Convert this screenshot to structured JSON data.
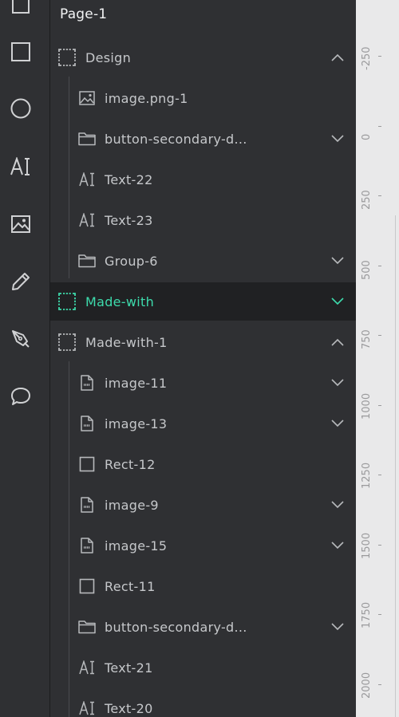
{
  "toolbar": {
    "tools": [
      {
        "name": "frame-tool",
        "icon": "frame-icon"
      },
      {
        "name": "rectangle-tool",
        "icon": "rectangle-icon"
      },
      {
        "name": "ellipse-tool",
        "icon": "circle-icon"
      },
      {
        "name": "text-tool",
        "icon": "text-icon"
      },
      {
        "name": "image-tool",
        "icon": "image-icon"
      },
      {
        "name": "pencil-tool",
        "icon": "pencil-icon"
      },
      {
        "name": "pen-tool",
        "icon": "pen-icon"
      },
      {
        "name": "comment-tool",
        "icon": "comment-icon"
      }
    ]
  },
  "layers": {
    "page_title": "Page-1",
    "rows": [
      {
        "label": "Design",
        "icon": "frame-icon",
        "chevron": "up",
        "level": 0
      },
      {
        "label": "image.png-1",
        "icon": "image-icon",
        "chevron": "",
        "level": 1
      },
      {
        "label": "button-secondary-d...",
        "icon": "folder-icon",
        "chevron": "down",
        "level": 1
      },
      {
        "label": "Text-22",
        "icon": "text-icon",
        "chevron": "",
        "level": 1
      },
      {
        "label": "Text-23",
        "icon": "text-icon",
        "chevron": "",
        "level": 1
      },
      {
        "label": "Group-6",
        "icon": "folder-icon",
        "chevron": "down",
        "level": 1
      },
      {
        "label": "Made-with",
        "icon": "frame-icon",
        "chevron": "down",
        "level": 0,
        "selected": true
      },
      {
        "label": "Made-with-1",
        "icon": "frame-icon",
        "chevron": "up",
        "level": 0
      },
      {
        "label": "image-11",
        "icon": "svg-file-icon",
        "chevron": "down",
        "level": 1
      },
      {
        "label": "image-13",
        "icon": "svg-file-icon",
        "chevron": "down",
        "level": 1
      },
      {
        "label": "Rect-12",
        "icon": "rectangle-icon",
        "chevron": "",
        "level": 1
      },
      {
        "label": "image-9",
        "icon": "svg-file-icon",
        "chevron": "down",
        "level": 1
      },
      {
        "label": "image-15",
        "icon": "svg-file-icon",
        "chevron": "down",
        "level": 1
      },
      {
        "label": "Rect-11",
        "icon": "rectangle-icon",
        "chevron": "",
        "level": 1
      },
      {
        "label": "button-secondary-d...",
        "icon": "folder-icon",
        "chevron": "down",
        "level": 1
      },
      {
        "label": "Text-21",
        "icon": "text-icon",
        "chevron": "",
        "level": 1
      },
      {
        "label": "Text-20",
        "icon": "text-icon",
        "chevron": "",
        "level": 1
      }
    ]
  },
  "ruler": {
    "labels": [
      "-250",
      "0",
      "250",
      "500",
      "750",
      "1000",
      "1250",
      "1500",
      "1750",
      "2000"
    ]
  },
  "colors": {
    "panel_bg": "#2f3033",
    "selected_bg": "#202123",
    "accent": "#3ddbac",
    "ruler_bg": "#e9e9ea"
  }
}
